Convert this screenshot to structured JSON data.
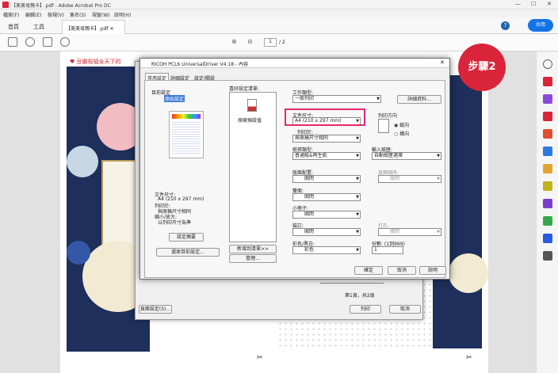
{
  "window": {
    "title": "【美美母親卡】.pdf - Adobe Acrobat Pro DC"
  },
  "menu": {
    "items": [
      "檔案(F)",
      "編輯(E)",
      "檢視(V)",
      "簽名(S)",
      "視窗(W)",
      "說明(H)"
    ]
  },
  "tabs": {
    "home": "首頁",
    "tools": "工具",
    "doc": "【美美母親卡】.pdf"
  },
  "toolbar": {
    "page_current": "1",
    "page_total": "/ 2",
    "share": "共用",
    "help": "?"
  },
  "page": {
    "title": "♥ 豆瓣祝福全天下的"
  },
  "badge": "步驟2",
  "print_dialog": {
    "advanced_button": "頁面設定(S)...",
    "page_info": "第1頁，共2頁",
    "print_button": "列印",
    "cancel_button": "取消"
  },
  "driver": {
    "title": "RICOH PCL6 UniversalDriver V4.18 - 內容",
    "tabs": [
      "常用設定",
      "詳細設定",
      "設定/關設"
    ],
    "current_settings_label": "目前設定",
    "preview_caption": "原始設定",
    "summary": {
      "lines": [
        "文件尺寸:",
        "A4 (210 x 297 mm)",
        "列印於:",
        "與原稿尺寸相同",
        "縮小/放大:",
        "以列印尺寸為準"
      ]
    },
    "setting_summary_btn": "設定摘要",
    "restore_defaults_btn": "還原目前設定...",
    "preset_list_label": "喜好設定清單:",
    "preset_item": "原廠預設值",
    "register_btn": "新增到清單>>",
    "manage_btn": "管理...",
    "job_type_label": "工作類型:",
    "job_type_value": "一般列印",
    "details_btn": "詳細資料...",
    "doc_size_label": "文件尺寸:",
    "doc_size_value": "A4 (210 x 297 mm)",
    "print_on_label": "列印於:",
    "print_on_value": "與原稿尺寸相同",
    "orientation_label": "列印方向",
    "orientation_portrait": "縱向",
    "orientation_landscape": "橫向",
    "paper_type_label": "紙張類型:",
    "paper_type_value": "普通紙&再生紙",
    "input_tray_label": "輸入紙匣:",
    "input_tray_value": "自動紙匣選擇",
    "layout_label": "版面配置:",
    "layout_value": "關閉",
    "page_order_label": "頁面順序:",
    "page_order_value": "關閉",
    "duplex_label": "雙面:",
    "duplex_value": "關閉",
    "booklet_label": "小冊子:",
    "booklet_value": "關閉",
    "staple_label": "裝訂:",
    "staple_value": "關閉",
    "punch_label": "打孔:",
    "punch_value": "關閉",
    "color_label": "彩色/黑白:",
    "color_value": "彩色",
    "copies_label": "份數: (1到999)",
    "copies_value": "1",
    "ok": "確定",
    "cancel": "取消",
    "help": "說明"
  },
  "colors": {
    "accent": "#1473e6",
    "badge": "#d9243a",
    "highlight": "#e22a6f",
    "poster": "#1d2f5a"
  }
}
